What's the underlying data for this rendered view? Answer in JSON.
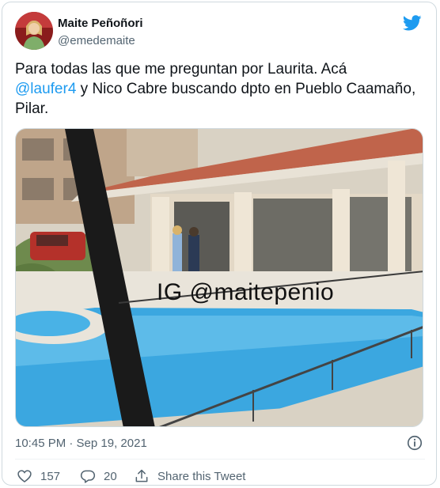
{
  "tweet": {
    "author_name": "Maite Peñoñori",
    "author_handle": "@emedemaite",
    "text_part1": "Para todas las que me preguntan por Laurita. Acá",
    "mention": "@laufer4",
    "text_part2": " y Nico Cabre buscando dpto en Pueblo Caamaño, Pilar.",
    "media_watermark": "IG @maitepenio",
    "timestamp": "10:45 PM · Sep 19, 2021",
    "likes": "157",
    "replies": "20",
    "share_label": "Share this Tweet"
  },
  "icons": {
    "brand": "twitter-bird-icon",
    "info": "info-icon",
    "like": "heart-icon",
    "reply": "reply-icon",
    "share": "share-icon"
  },
  "colors": {
    "accent": "#1d9bf0",
    "text": "#0f1419",
    "secondary": "#536471",
    "border": "#cfd9de"
  }
}
